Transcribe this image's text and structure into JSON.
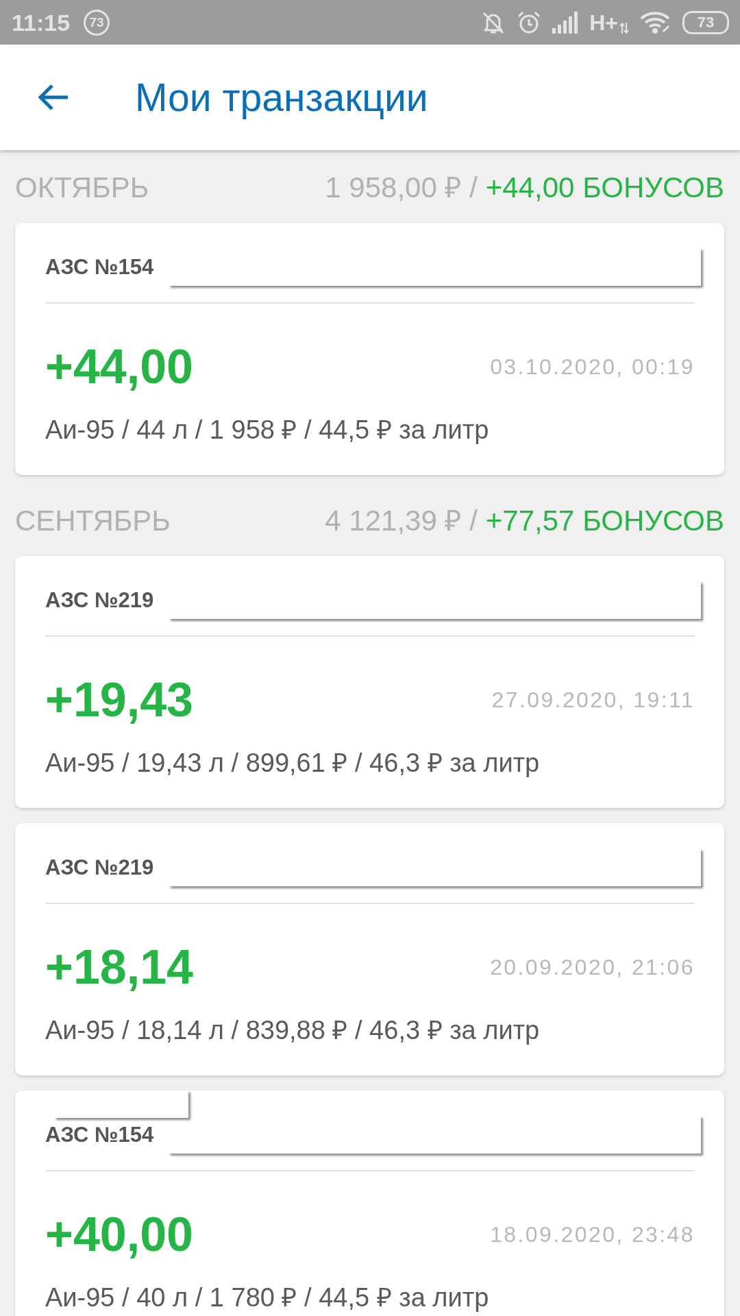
{
  "status_bar": {
    "time": "11:15",
    "notification_count": "73",
    "network": "H+",
    "battery": "73"
  },
  "app_bar": {
    "title": "Мои транзакции"
  },
  "months": [
    {
      "name": "ОКТЯБРЬ",
      "total": "1 958,00 ₽ /",
      "bonus": "+44,00 БОНУСОВ",
      "transactions": [
        {
          "station": "АЗС №154",
          "redacted": true,
          "amount": "+44,00",
          "datetime": "03.10.2020, 00:19",
          "details": "Аи-95 / 44 л / 1 958 ₽ / 44,5 ₽ за литр"
        }
      ]
    },
    {
      "name": "СЕНТЯБРЬ",
      "total": "4 121,39 ₽ /",
      "bonus": "+77,57 БОНУСОВ",
      "transactions": [
        {
          "station": "АЗС №219",
          "redacted": true,
          "amount": "+19,43",
          "datetime": "27.09.2020, 19:11",
          "details": "Аи-95 / 19,43 л / 899,61 ₽ / 46,3 ₽ за литр"
        },
        {
          "station": "АЗС №219",
          "redacted": true,
          "amount": "+18,14",
          "datetime": "20.09.2020, 21:06",
          "details": "Аи-95 / 18,14 л / 839,88 ₽ / 46,3 ₽ за литр"
        },
        {
          "station": "АЗС №154",
          "redacted": true,
          "label_covered": true,
          "amount": "+40,00",
          "datetime": "18.09.2020, 23:48",
          "details": "Аи-95 / 40 л / 1 780 ₽ / 44,5 ₽ за литр"
        }
      ]
    }
  ]
}
